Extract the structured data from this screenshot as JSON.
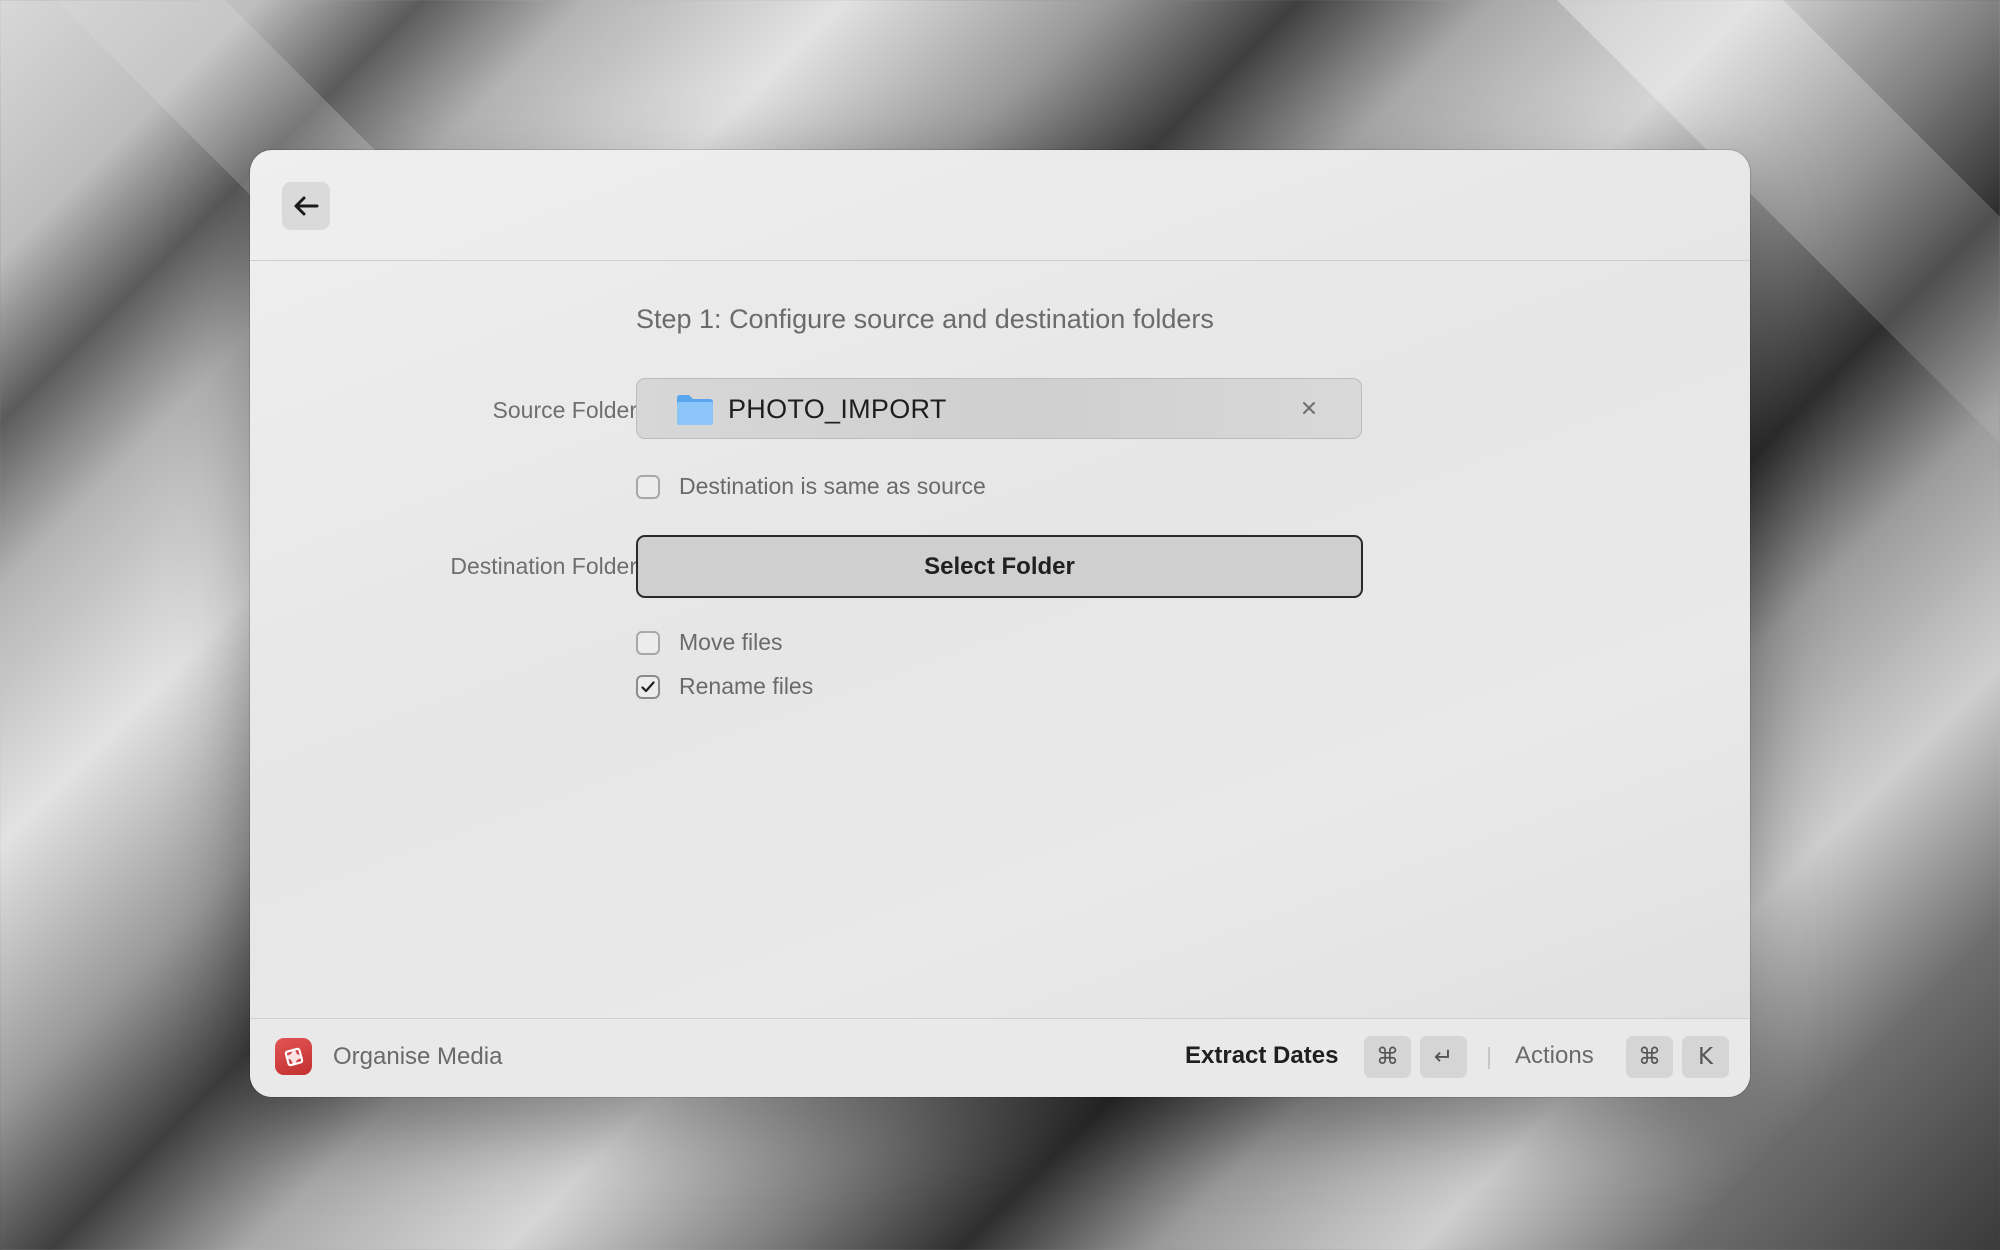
{
  "header": {
    "back_icon": "arrow-left-icon"
  },
  "main": {
    "step_title": "Step 1: Configure source and destination folders",
    "source": {
      "label": "Source Folder",
      "folder_name": "PHOTO_IMPORT",
      "folder_icon": "folder-icon",
      "clear_icon": "close-icon"
    },
    "options": {
      "same_destination": {
        "label": "Destination is same as source",
        "checked": false
      },
      "move_files": {
        "label": "Move files",
        "checked": false
      },
      "rename_files": {
        "label": "Rename files",
        "checked": true
      }
    },
    "destination": {
      "label": "Destination Folder",
      "button_label": "Select Folder"
    }
  },
  "footer": {
    "app_name": "Organise Media",
    "app_icon": "organise-media-icon",
    "primary_action": "Extract Dates",
    "primary_shortcut": [
      "⌘",
      "↵"
    ],
    "actions_label": "Actions",
    "actions_shortcut": [
      "⌘",
      "K"
    ]
  },
  "colors": {
    "app_icon_red": "#d94444",
    "folder_blue": "#6fb3f2",
    "button_border": "#2a2a2a"
  }
}
